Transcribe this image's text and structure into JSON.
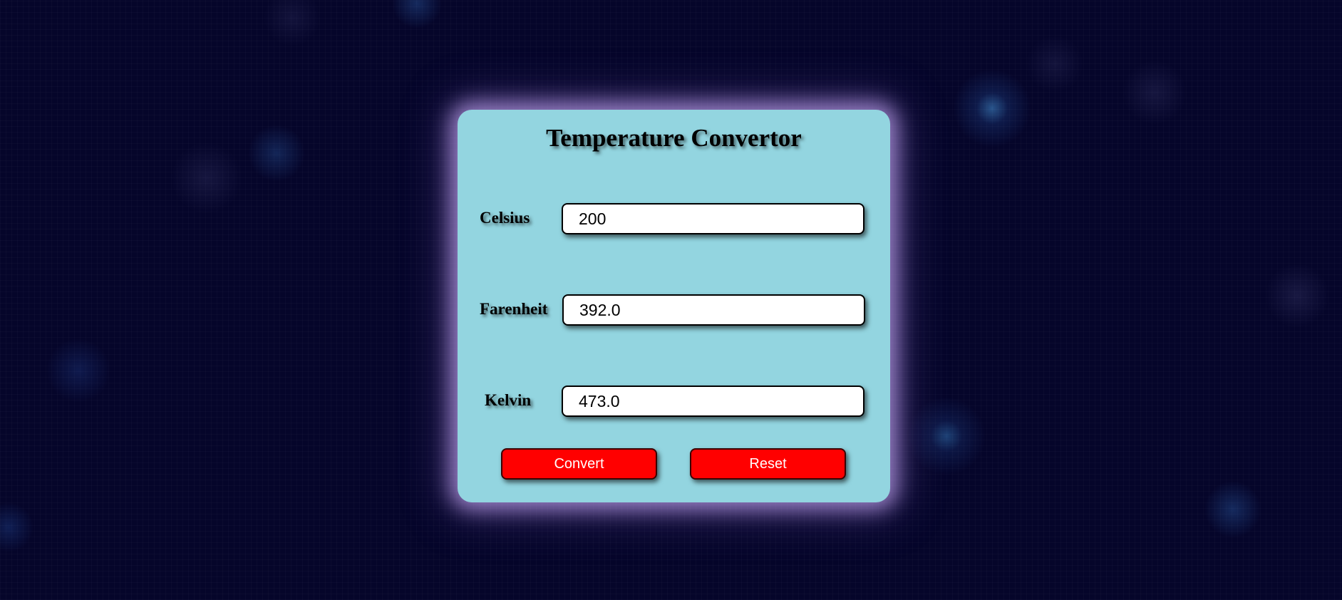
{
  "app": {
    "title": "Temperature Convertor"
  },
  "fields": {
    "celsius": {
      "label": "Celsius",
      "value": "200"
    },
    "fahrenheit": {
      "label": "Farenheit",
      "value": "392.0"
    },
    "kelvin": {
      "label": "Kelvin",
      "value": "473.0"
    }
  },
  "buttons": {
    "convert_label": "Convert",
    "reset_label": "Reset"
  },
  "colors": {
    "background": "#05052a",
    "card": "#93d5e0",
    "button": "#ff0000",
    "glow": "#bea0eb"
  }
}
